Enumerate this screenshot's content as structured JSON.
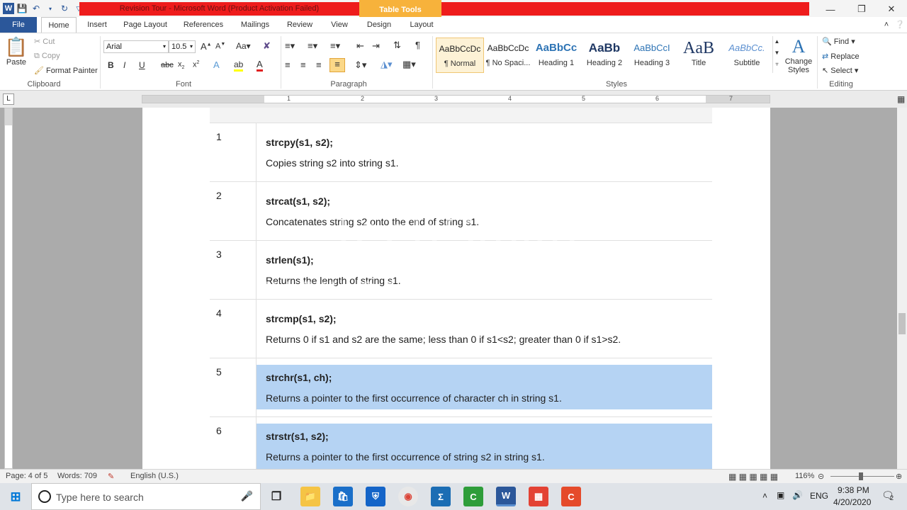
{
  "window": {
    "title": "Revision Tour - Microsoft Word (Product Activation Failed)",
    "context_tab": "Table Tools"
  },
  "tabs": [
    "File",
    "Home",
    "Insert",
    "Page Layout",
    "References",
    "Mailings",
    "Review",
    "View",
    "Design",
    "Layout"
  ],
  "clipboard": {
    "paste": "Paste",
    "cut": "Cut",
    "copy": "Copy",
    "format_painter": "Format Painter",
    "label": "Clipboard"
  },
  "font": {
    "name": "Arial",
    "size": "10.5",
    "label": "Font"
  },
  "paragraph": {
    "label": "Paragraph"
  },
  "styles": {
    "items": [
      {
        "preview": "AaBbCcDc",
        "name": "¶ Normal"
      },
      {
        "preview": "AaBbCcDc",
        "name": "¶ No Spaci..."
      },
      {
        "preview": "AaBbCc",
        "name": "Heading 1"
      },
      {
        "preview": "AaBb",
        "name": "Heading 2"
      },
      {
        "preview": "AaBbCcI",
        "name": "Heading 3"
      },
      {
        "preview": "AaB",
        "name": "Title"
      },
      {
        "preview": "AaBbCc.",
        "name": "Subtitle"
      }
    ],
    "change_styles": "Change Styles",
    "label": "Styles"
  },
  "editing": {
    "find": "Find",
    "replace": "Replace",
    "select": "Select",
    "label": "Editing"
  },
  "ruler": {
    "numbers": [
      "1",
      "1",
      "2",
      "3",
      "4",
      "5",
      "6",
      "7"
    ]
  },
  "table_rows": [
    {
      "num": "1",
      "fn": "strcpy(s1, s2);",
      "desc": "Copies string s2 into string s1.",
      "selected": false
    },
    {
      "num": "2",
      "fn": "strcat(s1, s2);",
      "desc": "Concatenates string s2 onto the end of string s1.",
      "selected": false
    },
    {
      "num": "3",
      "fn": "strlen(s1);",
      "desc": "Returns the length of string s1.",
      "selected": false
    },
    {
      "num": "4",
      "fn": "strcmp(s1, s2);",
      "desc": "Returns 0 if s1 and s2 are the same; less than 0 if s1<s2; greater than 0 if s1>s2.",
      "selected": false
    },
    {
      "num": "5",
      "fn": "strchr(s1, ch);",
      "desc": "Returns a pointer to the first occurrence of character ch in string s1.",
      "selected": true
    },
    {
      "num": "6",
      "fn": "strstr(s1, s2);",
      "desc": "Returns a pointer to the first occurrence of string s2 in string s1.",
      "selected": true
    }
  ],
  "watermark": {
    "logo": "TechSmith",
    "trial": "MADE WITH CAMTASIA FREE TRIAL"
  },
  "status": {
    "page": "Page: 4 of 5",
    "words": "Words: 709",
    "language": "English (U.S.)",
    "zoom": "116%"
  },
  "taskbar": {
    "search_placeholder": "Type here to search",
    "lang": "ENG",
    "time": "9:38 PM",
    "date": "4/20/2020",
    "notifications": "2"
  }
}
